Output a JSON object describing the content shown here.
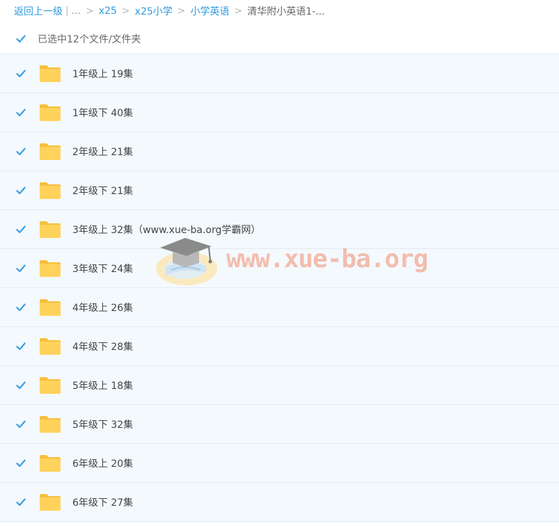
{
  "breadcrumb": {
    "back_label": "返回上一级",
    "pipe": "|",
    "ellipsis": "...",
    "sep": ">",
    "items": [
      "x25",
      "x25小学",
      "小学英语"
    ],
    "current": "清华附小英语1-..."
  },
  "selection": {
    "label": "已选中12个文件/文件夹",
    "checked": true
  },
  "files": [
    {
      "name": "1年级上 19集"
    },
    {
      "name": "1年级下 40集"
    },
    {
      "name": "2年级上 21集"
    },
    {
      "name": "2年级下 21集"
    },
    {
      "name": "3年级上 32集（www.xue-ba.org学霸网）"
    },
    {
      "name": "3年级下 24集"
    },
    {
      "name": "4年级上 26集"
    },
    {
      "name": "4年级下 28集"
    },
    {
      "name": "5年级上 18集"
    },
    {
      "name": "5年级下 32集"
    },
    {
      "name": "6年级上 20集"
    },
    {
      "name": "6年级下 27集"
    }
  ],
  "watermark": {
    "text": "www.xue-ba.org",
    "icon": "graduation-cap-icon"
  },
  "colors": {
    "accent": "#2f9ae0",
    "checkbox": "#3a9ee4",
    "folder": "#ffd25c",
    "row_bg": "#f4f9fd"
  }
}
